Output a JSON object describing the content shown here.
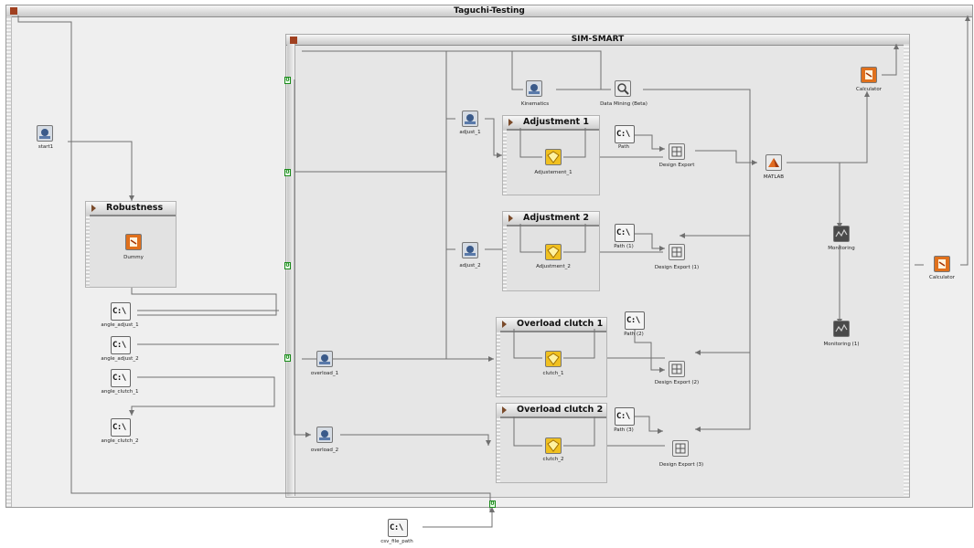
{
  "workflow": {
    "title": "Taguchi-Testing"
  },
  "subflow": {
    "title": "SIM-SMART"
  },
  "groups": {
    "robustness": "Robustness",
    "adj1": "Adjustment 1",
    "adj2": "Adjustment 2",
    "oc1": "Overload clutch 1",
    "oc2": "Overload clutch 2"
  },
  "nodes": {
    "start1": "start1",
    "dummy": "Dummy",
    "angle_adjust_1": "angle_adjust_1",
    "angle_adjust_2": "angle_adjust_2",
    "angle_clutch_1": "angle_clutch_1",
    "angle_clutch_2": "angle_clutch_2",
    "kinematics": "Kinematics",
    "data_mining": "Data Mining (Beta)",
    "adjust_1": "adjust_1",
    "adjustement_1": "Adjustement_1",
    "path": "Path",
    "design_export": "Design Export",
    "adjust_2": "adjust_2",
    "adjustment_2": "Adjustment_2",
    "path_1": "Path (1)",
    "design_export_1": "Design Export (1)",
    "path_2": "Path (2)",
    "overload_1": "overload_1",
    "clutch_1": "clutch_1",
    "design_export_2": "Design Export (2)",
    "overload_2": "overload_2",
    "clutch_2": "clutch_2",
    "path_3": "Path (3)",
    "design_export_3": "Design Export (3)",
    "matlab": "MATLAB",
    "calculator_inner": "Calculator",
    "monitoring": "Monitoring",
    "monitoring_1": "Monitoring (1)",
    "calculator_outer": "Calculator",
    "csv_file_path": "csv_file_path"
  },
  "terminal_icon_text": "C:\\",
  "colors": {
    "wire": "#707070",
    "gate": "#1b8a1b",
    "calc": "#e0701c",
    "yellow": "#f0c020"
  }
}
